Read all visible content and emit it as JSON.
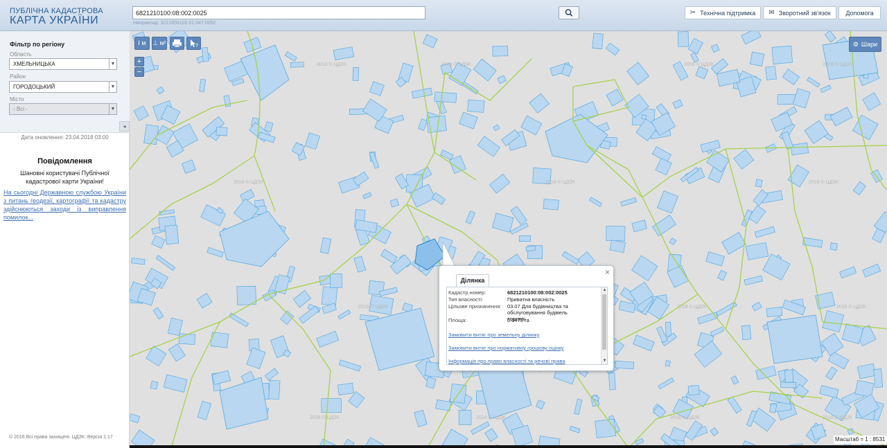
{
  "header": {
    "logo_top": "ПУБЛІЧНА КАДАСТРОВА",
    "logo_bottom": "КАРТА УКРАЇНИ",
    "search_value": "6821210100:08:002:0025",
    "search_hint": "Наприклад: 3221655100:01:047:0052",
    "support_label": "Технічна підтримка",
    "feedback_label": "Зворотний зв'язок",
    "help_label": "Допомога"
  },
  "sidebar": {
    "filter_title": "Фільтр по регіону",
    "oblast_label": "Область",
    "oblast_value": "ХМЕЛЬНИЦЬКА",
    "raion_label": "Район",
    "raion_value": "ГОРОДОЦЬКИЙ",
    "misto_label": "Місто",
    "misto_value": "- Всі -",
    "update_date": "Дата оновлення: 23.04.2018 03:00",
    "notice_title": "Повідомлення",
    "notice_text": "Шановні користувачі Публічної кадастрової карти України!",
    "notice_link": "На сьогодні Державною службою України з питань геодезії, картографії та кадастру здійснюються заходи із виправлення помилок...",
    "copyright": "© 2016 Всі права захищені. ЦДЗК. Версія 1.17"
  },
  "map": {
    "tools": {
      "measure_line": "I м",
      "measure_area": "⊥ м²",
      "print_icon": "printer-icon",
      "identify_icon": "identify-cursor-icon"
    },
    "zoom_in": "+",
    "zoom_out": "−",
    "layers_label": "Шари",
    "scale_text": "Масштаб = 1 : 8531",
    "watermark": "2018 © ЦДЗК",
    "colors": {
      "parcel_fill": "#b9d7f0",
      "parcel_stroke": "#4aa3e0",
      "boundary": "#a6d24a",
      "map_bg": "#e0e0e0",
      "tool_blue": "#5f87bb"
    }
  },
  "popup": {
    "tab_label": "Ділянка",
    "close": "×",
    "fields": [
      {
        "key": "Кадастр.номер:",
        "value": "6821210100:08:002:0025"
      },
      {
        "key": "Тип власності:",
        "value": "Приватна власність"
      },
      {
        "key": "Цільове призначення:",
        "value": "03.07 Для будівництва та обслуговування будівель торгівлі"
      },
      {
        "key": "Площа:",
        "value": "0.0473 га"
      }
    ],
    "links": [
      "Замовити витяг про земельну ділянку",
      "Замовити витяг про нормативну грошову оцінку",
      "Інформація про право власності та речові права"
    ]
  }
}
